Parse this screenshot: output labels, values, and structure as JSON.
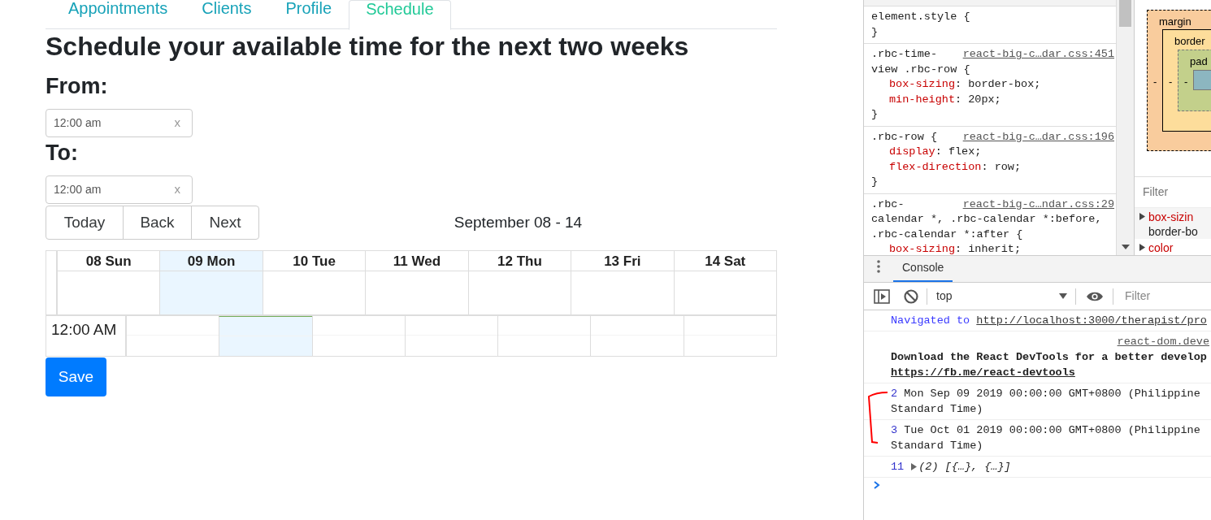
{
  "tabs": [
    {
      "label": "Appointments",
      "selected": false
    },
    {
      "label": "Clients",
      "selected": false
    },
    {
      "label": "Profile",
      "selected": false
    },
    {
      "label": "Schedule",
      "selected": true
    }
  ],
  "heading": "Schedule your available time for the next two weeks",
  "from": {
    "label": "From:",
    "value": "12:00 am",
    "clear": "x"
  },
  "to": {
    "label": "To:",
    "value": "12:00 am",
    "clear": "x"
  },
  "calendar": {
    "buttons": [
      "Today",
      "Back",
      "Next"
    ],
    "range": "September 08 - 14",
    "days": [
      {
        "label": "08 Sun",
        "today": false
      },
      {
        "label": "09 Mon",
        "today": true
      },
      {
        "label": "10 Tue",
        "today": false
      },
      {
        "label": "11 Wed",
        "today": false
      },
      {
        "label": "12 Thu",
        "today": false
      },
      {
        "label": "13 Fri",
        "today": false
      },
      {
        "label": "14 Sat",
        "today": false
      }
    ],
    "time_slot": "12:00 AM"
  },
  "save_button": "Save",
  "devtools": {
    "styles": [
      {
        "selector_lines": [
          "element.style {"
        ],
        "close": "}"
      },
      {
        "selector_lines": [
          ".rbc-time-",
          "view .rbc-row {"
        ],
        "source": "react-big-c…dar.css:451",
        "declarations": [
          {
            "property": "box-sizing",
            "separator": ":",
            "value": "border-box;"
          },
          {
            "property": "min-height",
            "separator": ":",
            "value": "20px;"
          }
        ],
        "close": "}"
      },
      {
        "selector_lines": [
          ".rbc-row {"
        ],
        "source": "react-big-c…dar.css:196",
        "declarations": [
          {
            "property": "display",
            "separator": ":",
            "value": "flex;"
          },
          {
            "property": "flex-direction",
            "separator": ":",
            "value": "row;"
          }
        ],
        "close": "}"
      },
      {
        "selector_lines": [
          ".rbc-",
          "calendar *, .rbc-calendar *:before,",
          ".rbc-calendar *:after {"
        ],
        "source": "react-big-c…ndar.css:29",
        "declarations": [
          {
            "property": "box-sizing",
            "separator": ":",
            "value": "inherit;"
          }
        ]
      }
    ],
    "box_model": {
      "margin": "margin",
      "border": "border",
      "padding": "pad",
      "values": [
        "-",
        "-",
        "-"
      ]
    },
    "computed_filter": {
      "placeholder": "Filter"
    },
    "computed": [
      {
        "property": "box-sizin",
        "value": "border-bo"
      },
      {
        "property": "color"
      }
    ],
    "console": {
      "tab": "Console",
      "context": "top",
      "filter_placeholder": "Filter",
      "messages": [
        {
          "kind": "navigation",
          "text": "Navigated to",
          "link": "http://localhost:3000/therapist/pro"
        },
        {
          "kind": "info",
          "source": "react-dom.deve",
          "text": "Download the React DevTools for a better develop",
          "link": "https://fb.me/react-devtools"
        },
        {
          "kind": "log",
          "count": "2",
          "text": "Mon Sep 09 2019 00:00:00 GMT+0800 (Philippine Standard Time)"
        },
        {
          "kind": "log",
          "count": "3",
          "text": "Tue Oct 01 2019 00:00:00 GMT+0800 (Philippine Standard Time)"
        },
        {
          "kind": "object",
          "count": "11",
          "text": "(2) [{…}, {…}]"
        }
      ]
    }
  }
}
